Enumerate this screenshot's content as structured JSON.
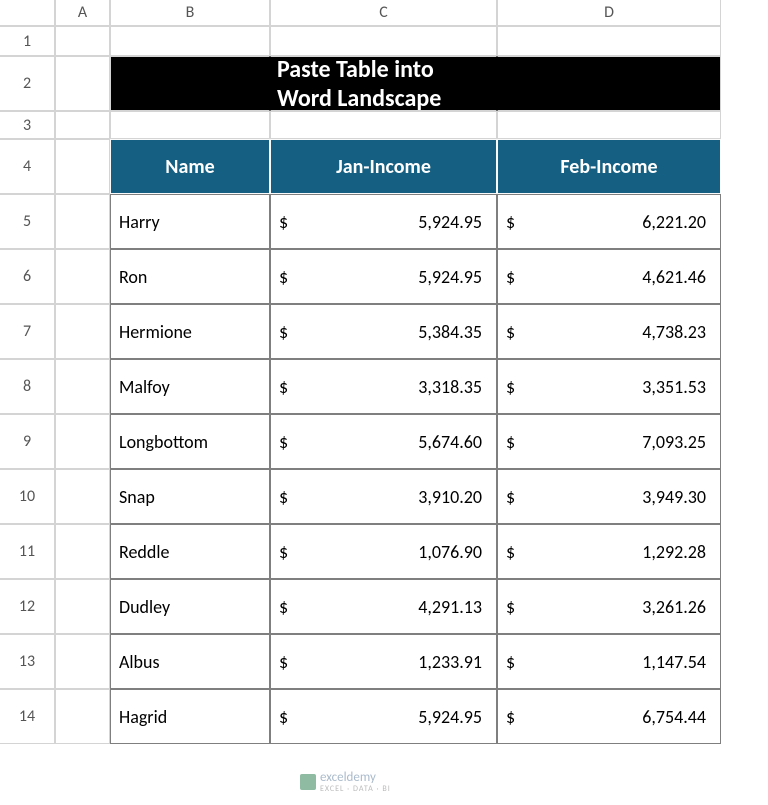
{
  "columns": [
    "",
    "A",
    "B",
    "C",
    "D"
  ],
  "row_numbers": [
    "1",
    "2",
    "3",
    "4",
    "5",
    "6",
    "7",
    "8",
    "9",
    "10",
    "11",
    "12",
    "13",
    "14"
  ],
  "title": "Paste Table into Word Landscape",
  "table_headers": [
    "Name",
    "Jan-Income",
    "Feb-Income"
  ],
  "currency_symbol": "$",
  "rows": [
    {
      "name": "Harry",
      "jan": "5,924.95",
      "feb": "6,221.20"
    },
    {
      "name": "Ron",
      "jan": "5,924.95",
      "feb": "4,621.46"
    },
    {
      "name": "Hermione",
      "jan": "5,384.35",
      "feb": "4,738.23"
    },
    {
      "name": "Malfoy",
      "jan": "3,318.35",
      "feb": "3,351.53"
    },
    {
      "name": "Longbottom",
      "jan": "5,674.60",
      "feb": "7,093.25"
    },
    {
      "name": "Snap",
      "jan": "3,910.20",
      "feb": "3,949.30"
    },
    {
      "name": "Reddle",
      "jan": "1,076.90",
      "feb": "1,292.28"
    },
    {
      "name": "Dudley",
      "jan": "4,291.13",
      "feb": "3,261.26"
    },
    {
      "name": "Albus",
      "jan": "1,233.91",
      "feb": "1,147.54"
    },
    {
      "name": "Hagrid",
      "jan": "5,924.95",
      "feb": "6,754.44"
    }
  ],
  "watermark": {
    "brand": "exceldemy",
    "sub": "EXCEL · DATA · BI"
  },
  "chart_data": {
    "type": "table",
    "title": "Paste Table into Word Landscape",
    "columns": [
      "Name",
      "Jan-Income",
      "Feb-Income"
    ],
    "currency": "USD",
    "data": [
      [
        "Harry",
        5924.95,
        6221.2
      ],
      [
        "Ron",
        5924.95,
        4621.46
      ],
      [
        "Hermione",
        5384.35,
        4738.23
      ],
      [
        "Malfoy",
        3318.35,
        3351.53
      ],
      [
        "Longbottom",
        5674.6,
        7093.25
      ],
      [
        "Snap",
        3910.2,
        3949.3
      ],
      [
        "Reddle",
        1076.9,
        1292.28
      ],
      [
        "Dudley",
        4291.13,
        3261.26
      ],
      [
        "Albus",
        1233.91,
        1147.54
      ],
      [
        "Hagrid",
        5924.95,
        6754.44
      ]
    ]
  }
}
